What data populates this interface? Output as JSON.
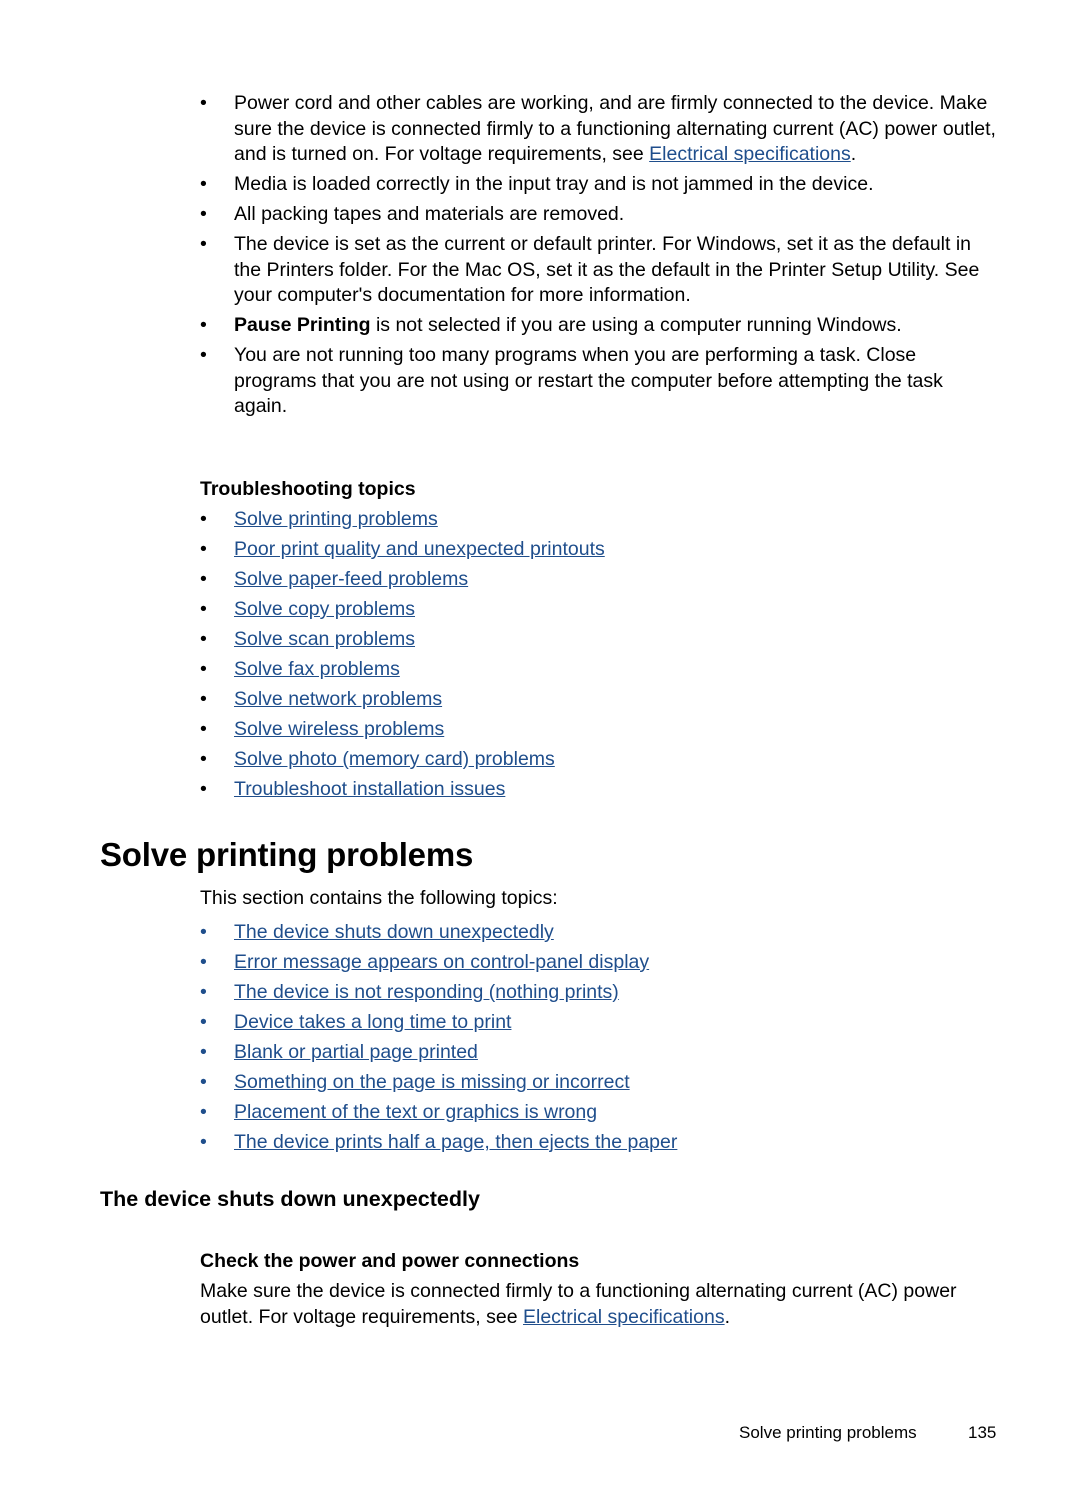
{
  "top_bullets": [
    {
      "text_before": "Power cord and other cables are working, and are firmly connected to the device. Make sure the device is connected firmly to a functioning alternating current (AC) power outlet, and is turned on. For voltage requirements, see ",
      "link": "Electrical specifications",
      "text_after": "."
    },
    {
      "text_before": "Media is loaded correctly in the input tray and is not jammed in the device.",
      "link": "",
      "text_after": ""
    },
    {
      "text_before": "All packing tapes and materials are removed.",
      "link": "",
      "text_after": ""
    },
    {
      "text_before": "The device is set as the current or default printer. For Windows, set it as the default in the Printers folder. For the Mac OS, set it as the default in the Printer Setup Utility. See your computer's documentation for more information.",
      "link": "",
      "text_after": ""
    },
    {
      "bold": "Pause Printing",
      "text_before": " is not selected if you are using a computer running Windows.",
      "link": "",
      "text_after": ""
    },
    {
      "text_before": "You are not running too many programs when you are performing a task. Close programs that you are not using or restart the computer before attempting the task again.",
      "link": "",
      "text_after": ""
    }
  ],
  "troubleshooting": {
    "heading": "Troubleshooting topics",
    "links": [
      "Solve printing problems",
      "Poor print quality and unexpected printouts",
      "Solve paper-feed problems",
      "Solve copy problems",
      "Solve scan problems",
      "Solve fax problems",
      "Solve network problems",
      "Solve wireless problems",
      "Solve photo (memory card) problems",
      "Troubleshoot installation issues"
    ]
  },
  "section": {
    "title": "Solve printing problems",
    "intro": "This section contains the following topics:",
    "links": [
      "The device shuts down unexpectedly",
      "Error message appears on control-panel display",
      "The device is not responding (nothing prints)",
      "Device takes a long time to print",
      "Blank or partial page printed",
      "Something on the page is missing or incorrect",
      "Placement of the text or graphics is wrong",
      "The device prints half a page, then ejects the paper"
    ]
  },
  "subsection": {
    "title": "The device shuts down unexpectedly",
    "subheading": "Check the power and power connections",
    "para_before": "Make sure the device is connected firmly to a functioning alternating current (AC) power outlet. For voltage requirements, see ",
    "para_link": "Electrical specifications",
    "para_after": "."
  },
  "footer": {
    "section_name": "Solve printing problems",
    "page_number": "135"
  },
  "bullet_char": "•"
}
